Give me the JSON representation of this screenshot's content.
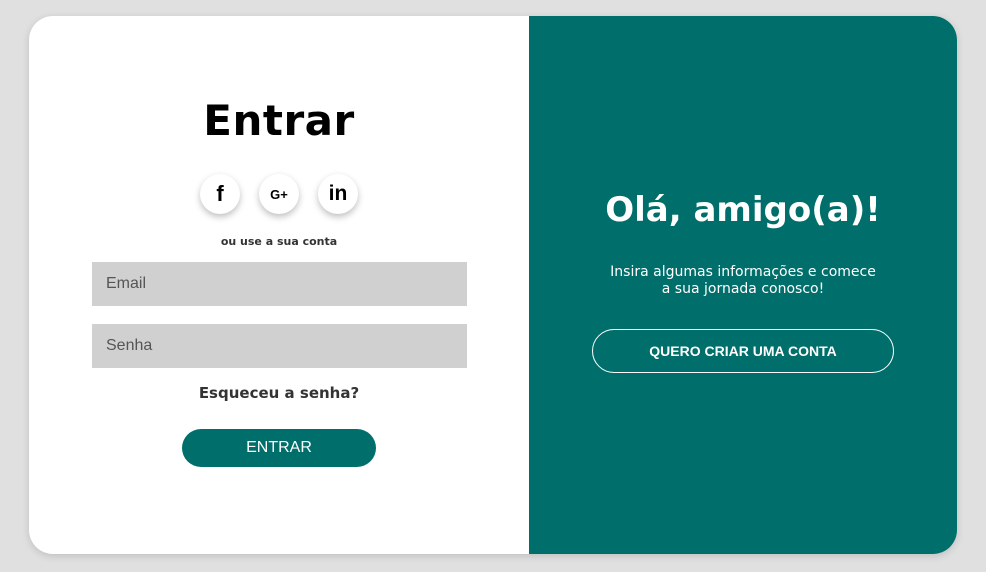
{
  "login": {
    "title": "Entrar",
    "social": [
      {
        "icon": "facebook-icon",
        "glyph": "f"
      },
      {
        "icon": "google-plus-icon",
        "glyph": "G+"
      },
      {
        "icon": "linkedin-icon",
        "glyph": "in"
      }
    ],
    "subtext": "ou use a sua conta",
    "email_placeholder": "Email",
    "password_placeholder": "Senha",
    "forgot_label": "Esqueceu a senha?",
    "submit_label": "ENTRAR"
  },
  "signup_panel": {
    "greeting": "Olá, amigo(a)!",
    "description_line1": "Insira algumas informações e comece",
    "description_line2": "a sua jornada conosco!",
    "button_label": "QUERO CRIAR UMA CONTA"
  },
  "colors": {
    "accent": "#006f6b",
    "input_bg": "#d0d0d0",
    "page_bg": "#e0e0e0"
  }
}
